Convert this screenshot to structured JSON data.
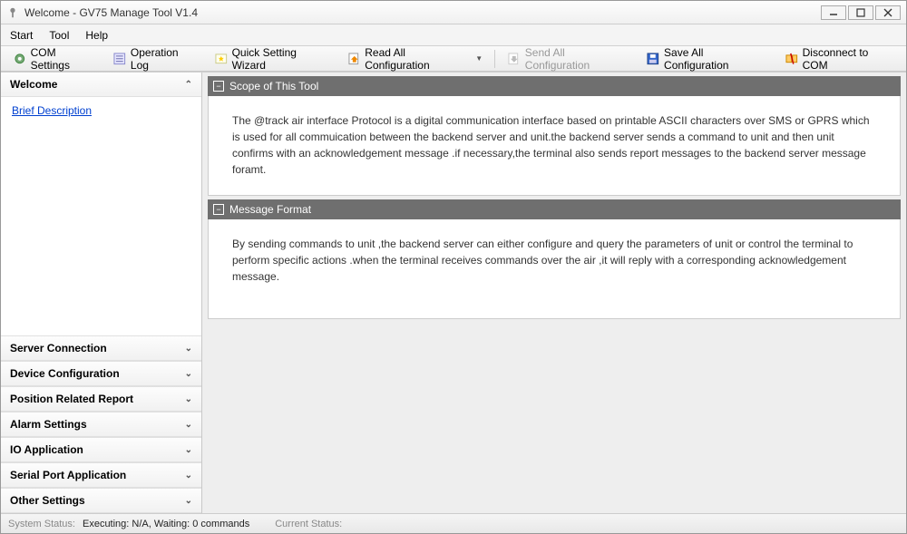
{
  "window": {
    "title": "Welcome - GV75 Manage Tool V1.4"
  },
  "menu": {
    "start": "Start",
    "tool": "Tool",
    "help": "Help"
  },
  "toolbar": {
    "com_settings": "COM Settings",
    "operation_log": "Operation Log",
    "quick_setting_wizard": "Quick Setting Wizard",
    "read_all_config": "Read All Configuration",
    "send_all_config": "Send All Configuration",
    "save_all_config": "Save All Configuration",
    "disconnect_com": "Disconnect to COM"
  },
  "sidebar": {
    "welcome": "Welcome",
    "brief_description": "Brief Description",
    "server_connection": "Server Connection",
    "device_configuration": "Device Configuration",
    "position_related_report": "Position Related Report",
    "alarm_settings": "Alarm Settings",
    "io_application": "IO Application",
    "serial_port_application": "Serial Port Application",
    "other_settings": "Other Settings"
  },
  "panels": {
    "scope_title": "Scope of This Tool",
    "scope_body": "The @track air interface Protocol is a digital communication interface based on printable ASCII characters over SMS or GPRS which is used for all commuication between the backend server and unit.the backend server sends a command to unit and then unit confirms with an acknowledgement message .if necessary,the terminal also sends report messages to the backend server message foramt.",
    "message_title": "Message Format",
    "message_body": "By sending commands to unit ,the backend server can either configure and query the parameters of unit or control the terminal to perform specific actions .when the terminal receives commands over the air ,it will reply with a corresponding acknowledgement message."
  },
  "status": {
    "system_status_label": "System Status:",
    "executing": "Executing: N/A, Waiting: 0 commands",
    "current_status_label": "Current Status:"
  }
}
